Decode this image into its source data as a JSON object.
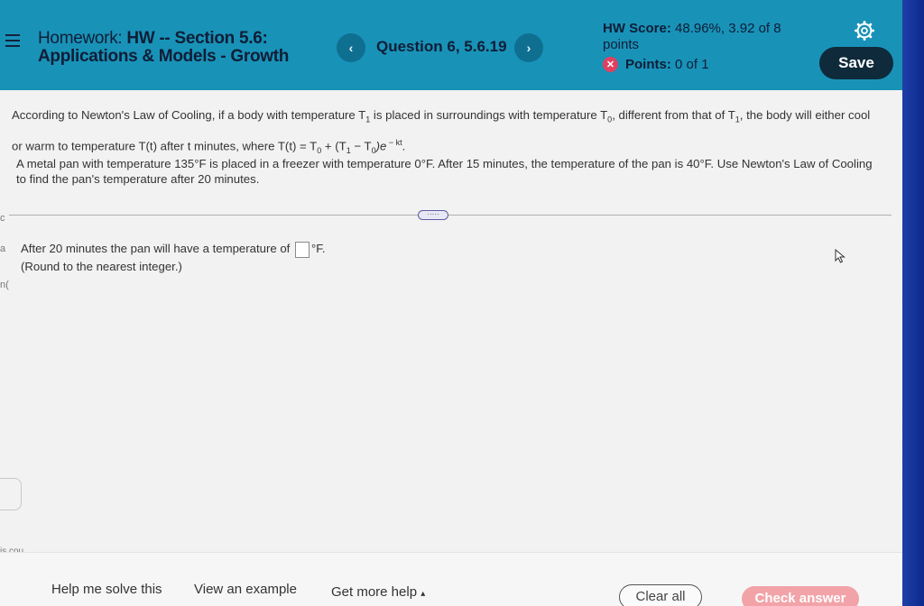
{
  "header": {
    "homework_prefix": "Homework:",
    "homework_title": "HW -- Section 5.6:",
    "homework_subtitle": "Applications & Models - Growth",
    "prev_icon": "‹",
    "next_icon": "›",
    "question": "Question 6, 5.6.19",
    "score_label": "HW Score:",
    "score_value": "48.96%, 3.92 of 8",
    "score_unit": "points",
    "points_label": "Points:",
    "points_value": "0 of 1",
    "save_label": "Save",
    "settings_icon": "gear-icon",
    "menu_icon": "hamburger-icon",
    "error_icon": "x-circle-icon"
  },
  "question_text": {
    "intro_a": "According to Newton's Law of Cooling, if a body with temperature T",
    "sub1": "1",
    "intro_b": " is placed in surroundings with temperature T",
    "sub0": "0",
    "intro_c": ", different from that of T",
    "sub1b": "1",
    "intro_d": ", the body will either cool",
    "intro_e": "or warm to temperature T(t) after t minutes, where T(t) = T",
    "f_sub0": "0",
    "f_mid": " + (T",
    "f_sub1": "1",
    "f_minus": " − T",
    "f_sub0b": "0",
    "f_end": ")e",
    "f_exp": " − kt",
    "f_period": ".",
    "problem_line1": "A metal pan with temperature 135°F is placed in a freezer with temperature 0°F. After 15 minutes, the temperature of the pan is 40°F. Use Newton's Law of Cooling",
    "problem_line2": "to find the pan's temperature after 20 minutes.",
    "more_pill": "·····"
  },
  "answer": {
    "prefix": "After 20 minutes the pan will have a temperature of",
    "unit": "°F.",
    "note": "(Round to the nearest integer.)",
    "value": ""
  },
  "left_fragments": {
    "frag1": "c",
    "frag2": "a",
    "frag3": "n(",
    "frag4": "is cou"
  },
  "footer": {
    "help_solve": "Help me solve this",
    "view_example": "View an example",
    "get_more_help": "Get more help",
    "more_help_arrow": "▴",
    "clear_all": "Clear all",
    "check_answer": "Check answer"
  },
  "colors": {
    "header_bg": "#1992b8",
    "save_bg": "#0e2a3b",
    "check_bg": "#f2a3a8",
    "error": "#e04060"
  }
}
